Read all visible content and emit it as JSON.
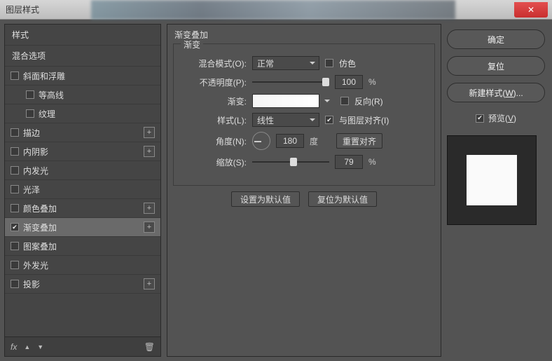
{
  "titlebar": {
    "title": "图层样式",
    "close_glyph": "✕"
  },
  "sidebar": {
    "header": "样式",
    "subheader": "混合选项",
    "items": [
      {
        "label": "斜面和浮雕",
        "checked": false,
        "indent": false,
        "plus": false
      },
      {
        "label": "等高线",
        "checked": false,
        "indent": true,
        "plus": false
      },
      {
        "label": "纹理",
        "checked": false,
        "indent": true,
        "plus": false
      },
      {
        "label": "描边",
        "checked": false,
        "indent": false,
        "plus": true
      },
      {
        "label": "内阴影",
        "checked": false,
        "indent": false,
        "plus": true
      },
      {
        "label": "内发光",
        "checked": false,
        "indent": false,
        "plus": false
      },
      {
        "label": "光泽",
        "checked": false,
        "indent": false,
        "plus": false
      },
      {
        "label": "颜色叠加",
        "checked": false,
        "indent": false,
        "plus": true
      },
      {
        "label": "渐变叠加",
        "checked": true,
        "indent": false,
        "plus": true,
        "selected": true
      },
      {
        "label": "图案叠加",
        "checked": false,
        "indent": false,
        "plus": false
      },
      {
        "label": "外发光",
        "checked": false,
        "indent": false,
        "plus": false
      },
      {
        "label": "投影",
        "checked": false,
        "indent": false,
        "plus": true
      }
    ],
    "footer": {
      "fx": "fx",
      "up": "▲",
      "down": "▼",
      "trash": "🗑"
    }
  },
  "content": {
    "section_title": "渐变叠加",
    "group_legend": "渐变",
    "rows": {
      "blend_mode": {
        "label": "混合模式(O):",
        "value": "正常",
        "dither_label": "仿色",
        "dither_checked": false
      },
      "opacity": {
        "label": "不透明度(P):",
        "value": "100",
        "unit": "%"
      },
      "gradient": {
        "label": "渐变:",
        "reverse_label": "反向(R)",
        "reverse_checked": false
      },
      "style": {
        "label": "样式(L):",
        "value": "线性",
        "align_label": "与图层对齐(I)",
        "align_checked": true
      },
      "angle": {
        "label": "角度(N):",
        "value": "180",
        "unit": "度",
        "reset_label": "重置对齐"
      },
      "scale": {
        "label": "缩放(S):",
        "value": "79",
        "unit": "%"
      }
    },
    "default_buttons": {
      "set": "设置为默认值",
      "reset": "复位为默认值"
    }
  },
  "right": {
    "ok": "确定",
    "cancel": "复位",
    "new_style_prefix": "新建样式(",
    "new_style_key": "W",
    "new_style_suffix": ")...",
    "preview_prefix": "预览(",
    "preview_key": "V",
    "preview_suffix": ")",
    "preview_checked": true
  }
}
